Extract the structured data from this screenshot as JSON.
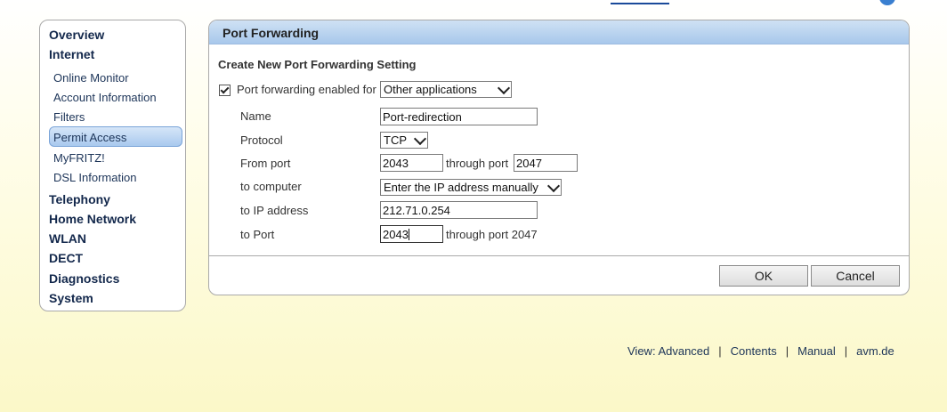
{
  "top_nav": {
    "items": [
      "",
      "",
      "",
      ""
    ]
  },
  "sidebar": {
    "main_items": [
      {
        "label": "Overview"
      },
      {
        "label": "Internet"
      },
      {
        "label": "Telephony"
      },
      {
        "label": "Home Network"
      },
      {
        "label": "WLAN"
      },
      {
        "label": "DECT"
      },
      {
        "label": "Diagnostics"
      },
      {
        "label": "System"
      }
    ],
    "internet_sub_items": [
      {
        "label": "Online Monitor"
      },
      {
        "label": "Account Information"
      },
      {
        "label": "Filters"
      },
      {
        "label": "Permit Access",
        "selected": true
      },
      {
        "label": "MyFRITZ!"
      },
      {
        "label": "DSL Information"
      }
    ]
  },
  "panel": {
    "title": "Port Forwarding",
    "section_title": "Create New Port Forwarding Setting",
    "enable_label": "Port forwarding enabled for",
    "enable_checked": true,
    "enable_for_value": "Other applications",
    "fields": {
      "name_label": "Name",
      "name_value": "Port-redirection",
      "protocol_label": "Protocol",
      "protocol_value": "TCP",
      "from_port_label": "From port",
      "from_port_value": "2043",
      "through_port_label": "through port",
      "through_port_value": "2047",
      "to_computer_label": "to computer",
      "to_computer_value": "Enter the IP address manually",
      "to_ip_label": "to IP address",
      "to_ip_value": "212.71.0.254",
      "to_port_label": "to Port",
      "to_port_value": "2043",
      "to_through_port_text": "through port 2047"
    },
    "ok_label": "OK",
    "cancel_label": "Cancel"
  },
  "footer": {
    "view_label": "View: Advanced",
    "contents_label": "Contents",
    "manual_label": "Manual",
    "site_label": "avm.de",
    "separator": "|"
  },
  "colors": {
    "header_blue": "#a8c8eb",
    "nav_text": "#13284c",
    "background_yellow": "#fbf8c8"
  }
}
